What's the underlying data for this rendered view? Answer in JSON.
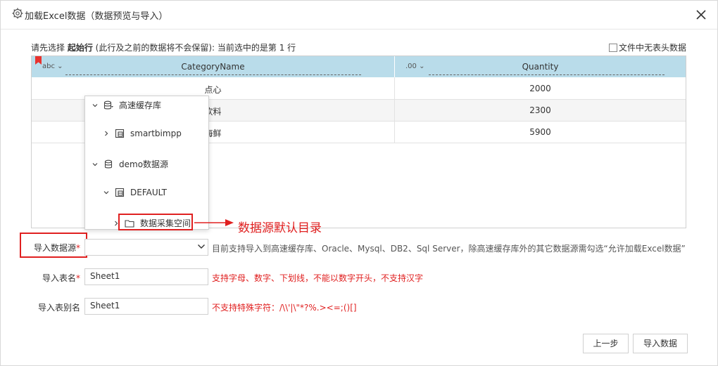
{
  "dialog": {
    "title": "加载Excel数据（数据预览与导入）"
  },
  "hint": {
    "prefix": "请先选择 ",
    "strong": "起始行",
    "suffix": " (此行及之前的数据将不会保留):  当前选中的是第 1 行"
  },
  "no_header_label": "文件中无表头数据",
  "grid": {
    "columns": [
      {
        "type": "abc",
        "name": "CategoryName"
      },
      {
        "type": ".00",
        "name": "Quantity"
      }
    ],
    "rows": [
      [
        "点心",
        "2000"
      ],
      [
        "饮料",
        "2300"
      ],
      [
        "海鲜",
        "5900"
      ]
    ]
  },
  "tree": {
    "nodes": [
      {
        "label": "高速缓存库",
        "icon": "database-icon",
        "expanded": true
      },
      {
        "label": "smartbimpp",
        "icon": "schema-icon",
        "expanded": false
      },
      {
        "label": "demo数据源",
        "icon": "database-icon",
        "expanded": true
      },
      {
        "label": "DEFAULT",
        "icon": "schema-icon",
        "expanded": true
      },
      {
        "label": "数据采集空间",
        "icon": "folder-icon",
        "expanded": false
      }
    ]
  },
  "callout": "数据源默认目录",
  "form": {
    "datasource_label": "导入数据源",
    "datasource_value": "",
    "datasource_note": "目前支持导入到高速缓存库、Oracle、Mysql、DB2、Sql Server，除高速缓存库外的其它数据源需勾选“允许加载Excel数据”",
    "table_label": "导入表名",
    "table_value": "Sheet1",
    "table_note": "支持字母、数字、下划线，不能以数字开头，不支持汉字",
    "alias_label": "导入表别名",
    "alias_value": "Sheet1",
    "alias_note": "不支持特殊字符：/\\\\'|\\\"*?%.><=;()[]",
    "required_mark": "*"
  },
  "buttons": {
    "prev": "上一步",
    "import": "导入数据"
  },
  "colors": {
    "accent_red": "#e02020",
    "header_blue": "#b9dcea"
  }
}
